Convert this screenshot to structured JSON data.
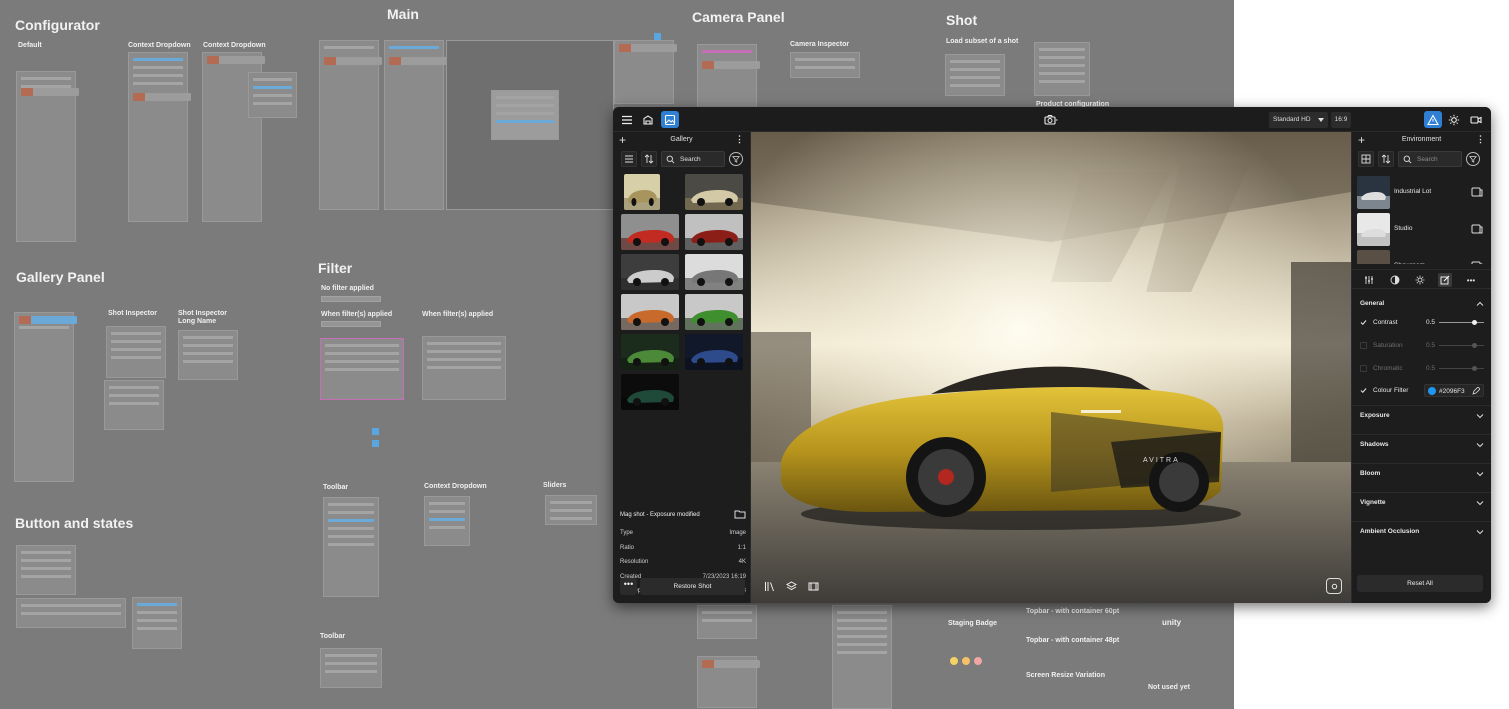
{
  "board": {
    "sections": {
      "configurator": "Configurator",
      "main": "Main",
      "camera_panel": "Camera Panel",
      "shot": "Shot",
      "gallery_panel": "Gallery Panel",
      "filter": "Filter",
      "button_states": "Button and states"
    },
    "labels": {
      "default": "Default",
      "context_dropdown_1": "Context Dropdown",
      "context_dropdown_2": "Context Dropdown",
      "camera_inspector": "Camera Inspector",
      "load_subset": "Load subset of a shot",
      "product_configuration": "Product configuration",
      "shot_inspector": "Shot Inspector",
      "shot_inspector_long": "Shot Inspector",
      "shot_inspector_long_2": "Long Name",
      "no_filter": "No filter applied",
      "filters_applied_1": "When filter(s) applied",
      "filters_applied_2": "When filter(s) applied",
      "toolbar_1": "Toolbar",
      "context_dropdown_3": "Context Dropdown",
      "sliders": "Sliders",
      "toolbar_2": "Toolbar",
      "staging_badge": "Staging Badge",
      "topbar_60": "Topbar - with container 60pt",
      "topbar_48": "Topbar - with container 48pt",
      "screen_resize": "Screen Resize Variation",
      "not_used_yet": "Not used yet",
      "unity_logo": "unity"
    }
  },
  "app": {
    "topbar": {
      "resolution": "Standard HD",
      "ratio": "16:9",
      "icons": [
        "menu-icon",
        "car-icon",
        "gallery-icon",
        "camera-icon",
        "warning-icon",
        "sun-icon",
        "video-icon"
      ]
    },
    "gallery": {
      "title": "Gallery",
      "search_label": "Search",
      "thumbnail_count": 12,
      "selected_title": "Mag shot - Exposure modified",
      "details": [
        {
          "label": "Type",
          "value": "Image"
        },
        {
          "label": "Ratio",
          "value": "1:1"
        },
        {
          "label": "Resolution",
          "value": "4K"
        },
        {
          "label": "Created",
          "value": "7/23/2023 16:19"
        },
        {
          "label": "Last Opened",
          "value": "7/24/2023 14:23"
        }
      ],
      "restore_label": "Restore Shot",
      "more_label": "•••"
    },
    "viewport": {
      "car_badge": "AVITRA"
    },
    "environment": {
      "title": "Environment",
      "search_placeholder": "Search",
      "items": [
        {
          "name": "Industrial Lot"
        },
        {
          "name": "Studio"
        },
        {
          "name": "Showroom"
        }
      ],
      "general": {
        "title": "General",
        "props": [
          {
            "name": "Contrast",
            "value": "0.5",
            "enabled": true,
            "level": 0.5
          },
          {
            "name": "Saturation",
            "value": "0.5",
            "enabled": false,
            "level": 0.5
          },
          {
            "name": "Chromatic",
            "value": "0.5",
            "enabled": false,
            "level": 0.5
          }
        ],
        "colour_filter": {
          "name": "Colour Filter",
          "hex": "#2096F3",
          "enabled": true
        }
      },
      "sections": [
        "Exposure",
        "Shadows",
        "Bloom",
        "Vignette",
        "Ambient Occlusion"
      ],
      "reset_label": "Reset All"
    },
    "colors": {
      "accent": "#2f7fd3",
      "swatch": "#2096F3",
      "panel": "#1d1d1d"
    }
  }
}
